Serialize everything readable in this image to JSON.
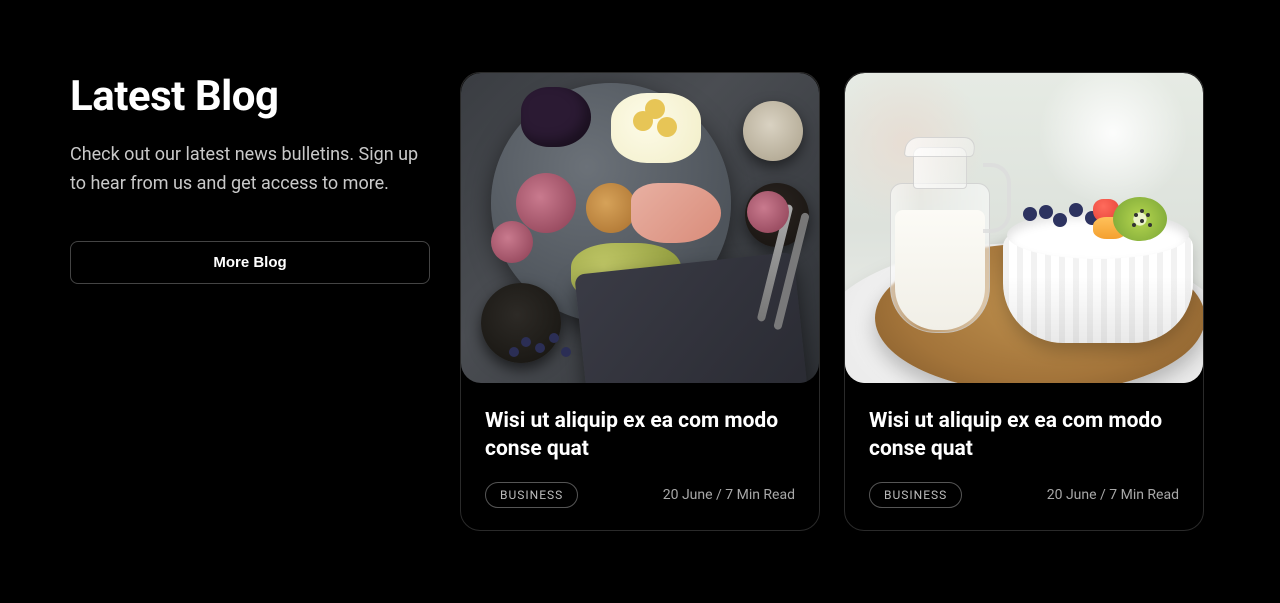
{
  "header": {
    "title": "Latest Blog",
    "subtitle": "Check out our latest news bulletins. Sign up to hear from us and get access to more.",
    "more_button": "More Blog"
  },
  "posts": [
    {
      "title": "Wisi ut aliquip ex ea com modo conse quat",
      "category": "BUSINESS",
      "meta": "20 June / 7 Min Read",
      "image_alt": "food-platter-charcuterie"
    },
    {
      "title": "Wisi ut aliquip ex ea com modo conse quat",
      "category": "BUSINESS",
      "meta": "20 June / 7 Min Read",
      "image_alt": "milk-pitcher-fruit-bowl"
    }
  ]
}
